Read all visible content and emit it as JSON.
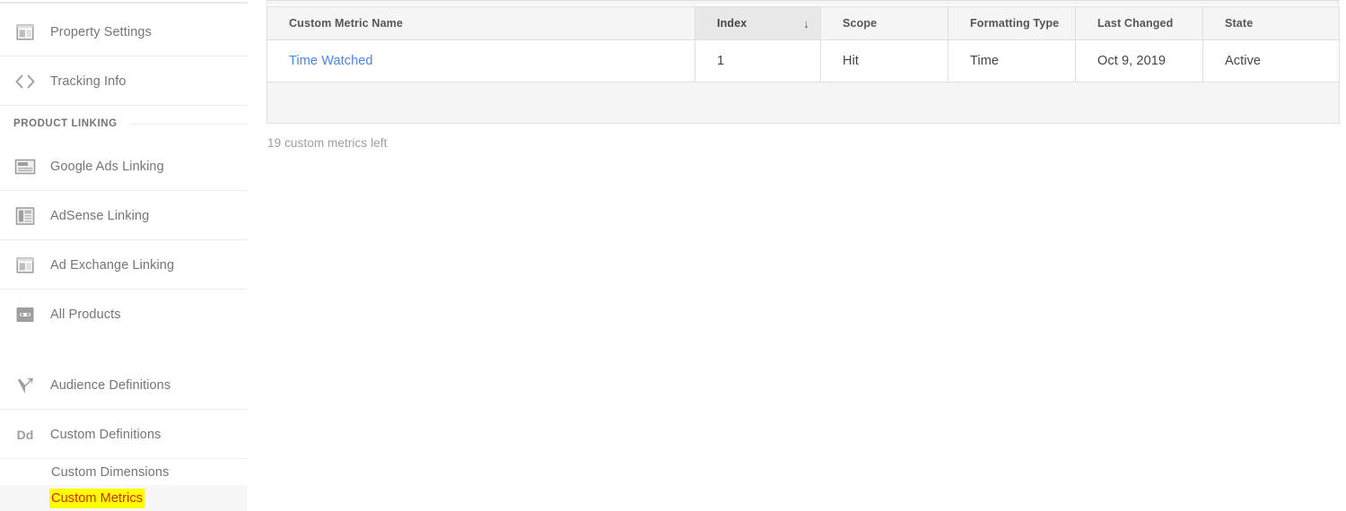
{
  "sidebar": {
    "items": [
      {
        "label": "Property Settings",
        "icon": "property-settings-icon",
        "type": "nav",
        "divider_below": true
      },
      {
        "label": "Tracking Info",
        "icon": "code-brackets-icon",
        "type": "nav",
        "divider_below": true
      }
    ],
    "section_header": "PRODUCT LINKING",
    "product_linking": [
      {
        "label": "Google Ads Linking",
        "icon": "google-ads-icon",
        "divider_below": true
      },
      {
        "label": "AdSense Linking",
        "icon": "adsense-icon",
        "divider_below": true
      },
      {
        "label": "Ad Exchange Linking",
        "icon": "ad-exchange-icon",
        "divider_below": true
      },
      {
        "label": "All Products",
        "icon": "all-products-icon",
        "divider_below": false
      }
    ],
    "definitions": [
      {
        "label": "Audience Definitions",
        "icon": "audience-definitions-icon",
        "divider_below": true
      },
      {
        "label": "Custom Definitions",
        "icon": "custom-definitions-icon",
        "divider_below": true
      }
    ],
    "sub_items": [
      {
        "label": "Custom Dimensions",
        "selected": false
      },
      {
        "label": "Custom Metrics",
        "selected": true
      }
    ],
    "highlight_color": "#ffff00",
    "highlight_text_color": "#dd2200",
    "text_color": "#757575"
  },
  "main": {
    "table": {
      "columns": [
        {
          "label": "Custom Metric Name",
          "sorted": false
        },
        {
          "label": "Index",
          "sorted": true,
          "sort_arrow": "↓"
        },
        {
          "label": "Scope",
          "sorted": false
        },
        {
          "label": "Formatting Type",
          "sorted": false
        },
        {
          "label": "Last Changed",
          "sorted": false
        },
        {
          "label": "State",
          "sorted": false
        }
      ],
      "rows": [
        {
          "name": "Time Watched",
          "index": "1",
          "scope": "Hit",
          "formatting_type": "Time",
          "last_changed": "Oct 9, 2019",
          "state": "Active"
        }
      ],
      "link_color": "#4285f4"
    },
    "metrics_left_text": "19 custom metrics left"
  }
}
